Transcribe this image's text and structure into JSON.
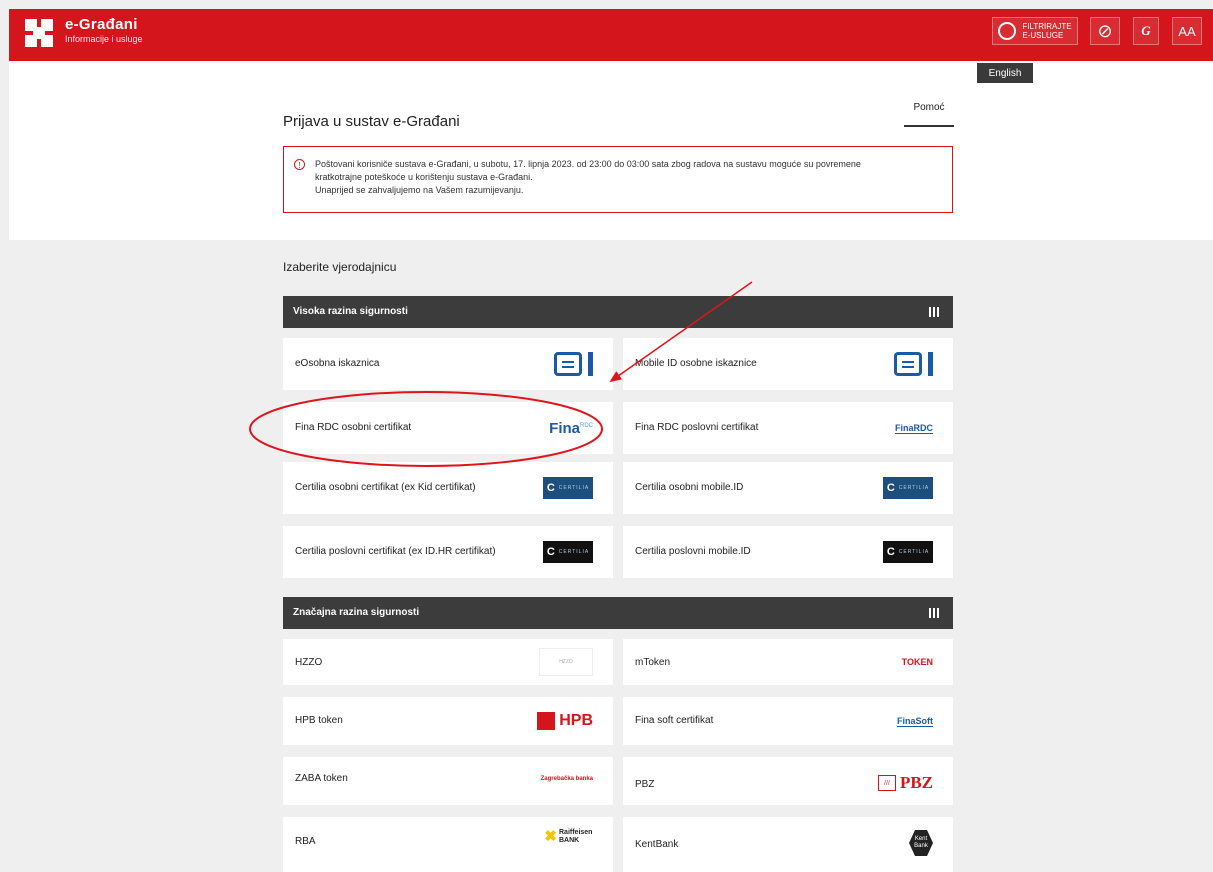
{
  "header": {
    "title": "e-Građani",
    "subtitle": "Informacije i usluge",
    "filter_label_1": "FILTRIRAJTE",
    "filter_label_2": "E-USLUGE",
    "eye_icon_glyph": "⊘",
    "g_label": "G",
    "aa_label": "AA",
    "language": "English",
    "brand_color": "#d4151c"
  },
  "login": {
    "title": "Prijava u sustav e-Građani",
    "help": "Pomoć",
    "notice_line1": "Poštovani korisniče sustava e-Građani, u subotu, 17. lipnja 2023. od 23:00 do 03:00 sata zbog radova na sustavu moguće su povremene",
    "notice_line2": "kratkotrajne poteškoće u korištenju sustava e-Građani.",
    "notice_line3": "Unaprijed se zahvaljujemo na Vašem razumijevanju."
  },
  "credentials": {
    "choose_label": "Izaberite vjerodajnicu",
    "sections": [
      {
        "title": "Visoka razina sigurnosti",
        "items": [
          {
            "name": "eOsobna iskaznica",
            "logo": "eid-icon"
          },
          {
            "name": "Mobile ID osobne iskaznice",
            "logo": "eid-icon"
          },
          {
            "name": "Fina RDC osobni certifikat",
            "logo": "Fina"
          },
          {
            "name": "Fina RDC poslovni certifikat",
            "logo": "FinaRDC"
          },
          {
            "name": "Certilia osobni certifikat (ex Kid certifikat)",
            "logo": "CERTILIA"
          },
          {
            "name": "Certilia osobni mobile.ID",
            "logo": "CERTILIA"
          },
          {
            "name": "Certilia poslovni certifikat (ex ID.HR certifikat)",
            "logo": "CERTILIA"
          },
          {
            "name": "Certilia poslovni mobile.ID",
            "logo": "CERTILIA"
          }
        ]
      },
      {
        "title": "Značajna razina sigurnosti",
        "items": [
          {
            "name": "HZZO",
            "logo": "HZZO"
          },
          {
            "name": "mToken",
            "logo": "TOKEN"
          },
          {
            "name": "HPB token",
            "logo": "HPB"
          },
          {
            "name": "Fina soft certifikat",
            "logo": "FinaSoft"
          },
          {
            "name": "ZABA token",
            "logo": "Zagrebačka banka"
          },
          {
            "name": "PBZ",
            "logo": "PBZ"
          },
          {
            "name": "RBA",
            "logo": "Raiffeisen BANK"
          },
          {
            "name": "KentBank",
            "logo": "Kent Bank"
          }
        ]
      }
    ]
  },
  "annotation_color": "#e0141b"
}
